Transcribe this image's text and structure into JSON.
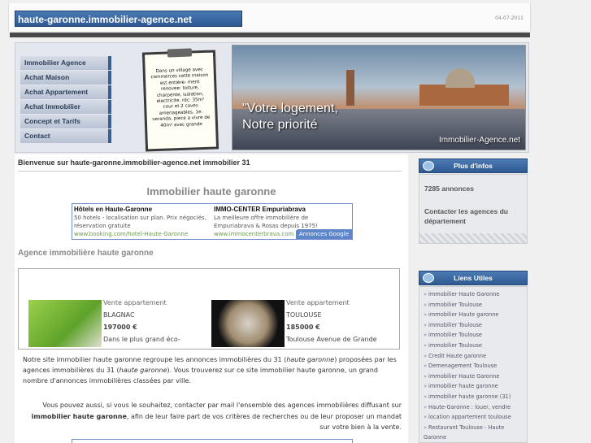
{
  "header": {
    "site_title": "haute-garonne.immobilier-agence.net",
    "date": "04-07-2011"
  },
  "nav": {
    "items": [
      {
        "label": "Immobilier Agence"
      },
      {
        "label": "Achat Maison"
      },
      {
        "label": "Achat Appartement"
      },
      {
        "label": "Achat Immobilier"
      },
      {
        "label": "Concept et Tarifs"
      },
      {
        "label": "Contact"
      }
    ]
  },
  "note": {
    "text": "Dans un village avec commerces cette maison est entière- ment renovee: toiture, charpente, isolation, electricite. rdc: 35m² cour et 2 caves amenageables. 1e: veranda, piece a vivre de 40m² avec grande"
  },
  "banner": {
    "slogan_line1": "\"Votre logement,",
    "slogan_line2": "Notre priorité",
    "watermark": "Immobilier-Agence.net"
  },
  "main": {
    "welcome": "Bienvenue sur haute-garonne.immobilier-agence.net immobilier 31",
    "heading": "Immobilier haute garonne",
    "ads": [
      {
        "title": "Hôtels en Haute-Garonne",
        "line1": "50 hotels - localisation sur plan. Prix négociés,",
        "line2": "réservation gratuite",
        "url": "www.booking.com/hotel-Haute-Garonne"
      },
      {
        "title": "IMMO-CENTER Empuriabrava",
        "line1": "La meilleure offre immobilière de",
        "line2": "Empuriabrava & Rosas depuis 1975!",
        "url": "www.immocenterbrava.com"
      }
    ],
    "ads_badge": "Annonces Google",
    "subheading": "Agence immobilière haute garonne",
    "listings": [
      {
        "title": "Vente appartement",
        "city": "BLAGNAC",
        "price": "197000 €",
        "desc": "Dans le plus grand éco-"
      },
      {
        "title": "Vente appartement",
        "city": "TOULOUSE",
        "price": "185000 €",
        "desc": "Toulouse Avenue de Grande"
      }
    ],
    "para1_a": "Notre site immobilier haute garonne regroupe les annonces immobilières du 31 (",
    "para1_em1": "haute garonne",
    "para1_b": ") proposées par les agences immobilières du 31 (",
    "para1_em2": "haute garonne",
    "para1_c": "). Vous trouverez sur ce site immobilier haute garonne, un grand nombre d'annonces immobilières classées par ville.",
    "para2_a": "Vous pouvez aussi, si vous le souhaitez, contacter par mail l'ensemble des agences immobilières diffusant sur ",
    "para2_strong": "immobilier haute garonne",
    "para2_b": ", afin de leur faire part de vos critères de recherches ou de leur proposer un mandat sur votre bien à la vente."
  },
  "sidebar": {
    "infos_title": "Plus d'infos",
    "annonces": "7285 annonces",
    "contact_agences": "Contacter les agences du département",
    "links_title": "Liens Utiles",
    "bullet": "»",
    "links": [
      "immobilier Haute Garonne",
      "immobilier Toulouse",
      "immobilier Haute garonne",
      "immobilier Toulouse",
      "immobilier Toulouse",
      "immobilier Toulouse",
      "Credit Haute garonne",
      "Demenagement Toulouse",
      "immobilier Haute Garonne",
      "immobilier haute garonne",
      "immobilier haute garonne (31)",
      "Haute-Garonne : louer, vendre",
      "location appartement toulouse",
      "Restaurant Toulouse - Haute",
      "Garonne"
    ]
  }
}
